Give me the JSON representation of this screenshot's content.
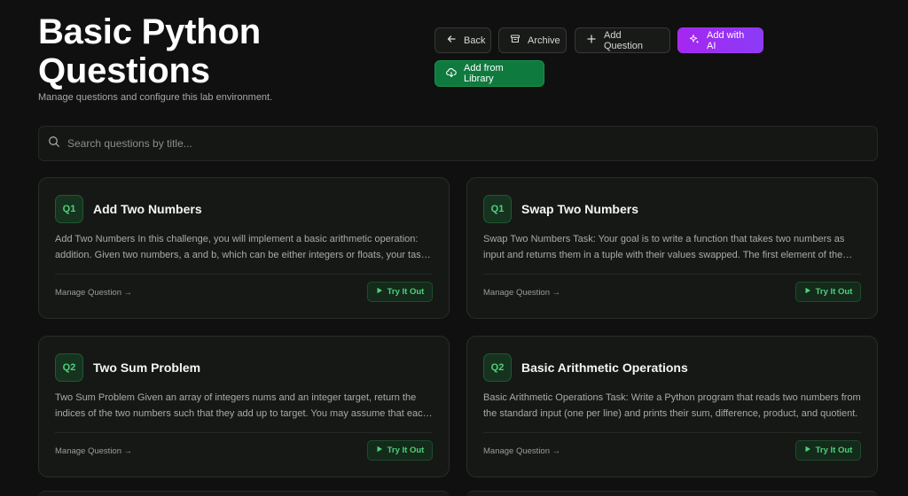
{
  "header": {
    "title": "Basic Python Questions",
    "subtitle": "Manage questions and configure this lab environment."
  },
  "actions": {
    "back": "Back",
    "archive": "Archive",
    "add_question": "Add Question",
    "add_ai": "Add with AI",
    "add_library": "Add from Library"
  },
  "search": {
    "placeholder": "Search questions by title...",
    "value": ""
  },
  "cards": [
    {
      "badge": "Q1",
      "title": "Add Two Numbers",
      "description": "Add Two Numbers In this challenge, you will implement a basic arithmetic operation: addition. Given two numbers, a and b, which can be either integers or floats, your task is to return their sum.",
      "manage": "Manage Question →",
      "try": "Try It Out"
    },
    {
      "badge": "Q1",
      "title": "Swap Two Numbers",
      "description": "Swap Two Numbers Task: Your goal is to write a function that takes two numbers as input and returns them in a tuple with their values swapped. The first element of the tuple should be the second number.",
      "manage": "Manage Question →",
      "try": "Try It Out"
    },
    {
      "badge": "Q2",
      "title": "Two Sum Problem",
      "description": "Two Sum Problem Given an array of integers nums and an integer target, return the indices of the two numbers such that they add up to target. You may assume that each input would have exactly one solution.",
      "manage": "Manage Question →",
      "try": "Try It Out"
    },
    {
      "badge": "Q2",
      "title": "Basic Arithmetic Operations",
      "description": "Basic Arithmetic Operations Task: Write a Python program that reads two numbers from the standard input (one per line) and prints their sum, difference, product, and quotient.",
      "manage": "Manage Question →",
      "try": "Try It Out"
    }
  ],
  "colors": {
    "background": "#101010",
    "accent_green": "#4ed17a",
    "library_button": "#0f7a3e",
    "ai_button": "#a626f0"
  },
  "icons": {
    "back": "arrow-left-icon",
    "archive": "archive-icon",
    "add_question": "plus-icon",
    "add_ai": "sparkles-icon",
    "add_library": "cloud-download-icon",
    "search": "search-icon",
    "try": "play-icon"
  }
}
